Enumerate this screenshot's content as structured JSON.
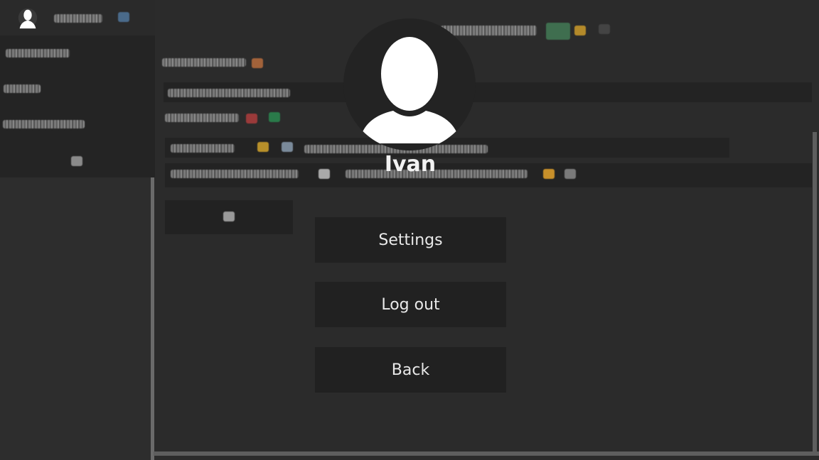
{
  "overlay": {
    "user_name": "Ivan",
    "buttons": {
      "settings": "Settings",
      "logout": "Log out",
      "back": "Back"
    }
  },
  "icons": {
    "avatar": "user-silhouette-icon"
  },
  "colors": {
    "background": "#2c2c2c",
    "button": "#212121",
    "text": "#e9e9e9"
  }
}
